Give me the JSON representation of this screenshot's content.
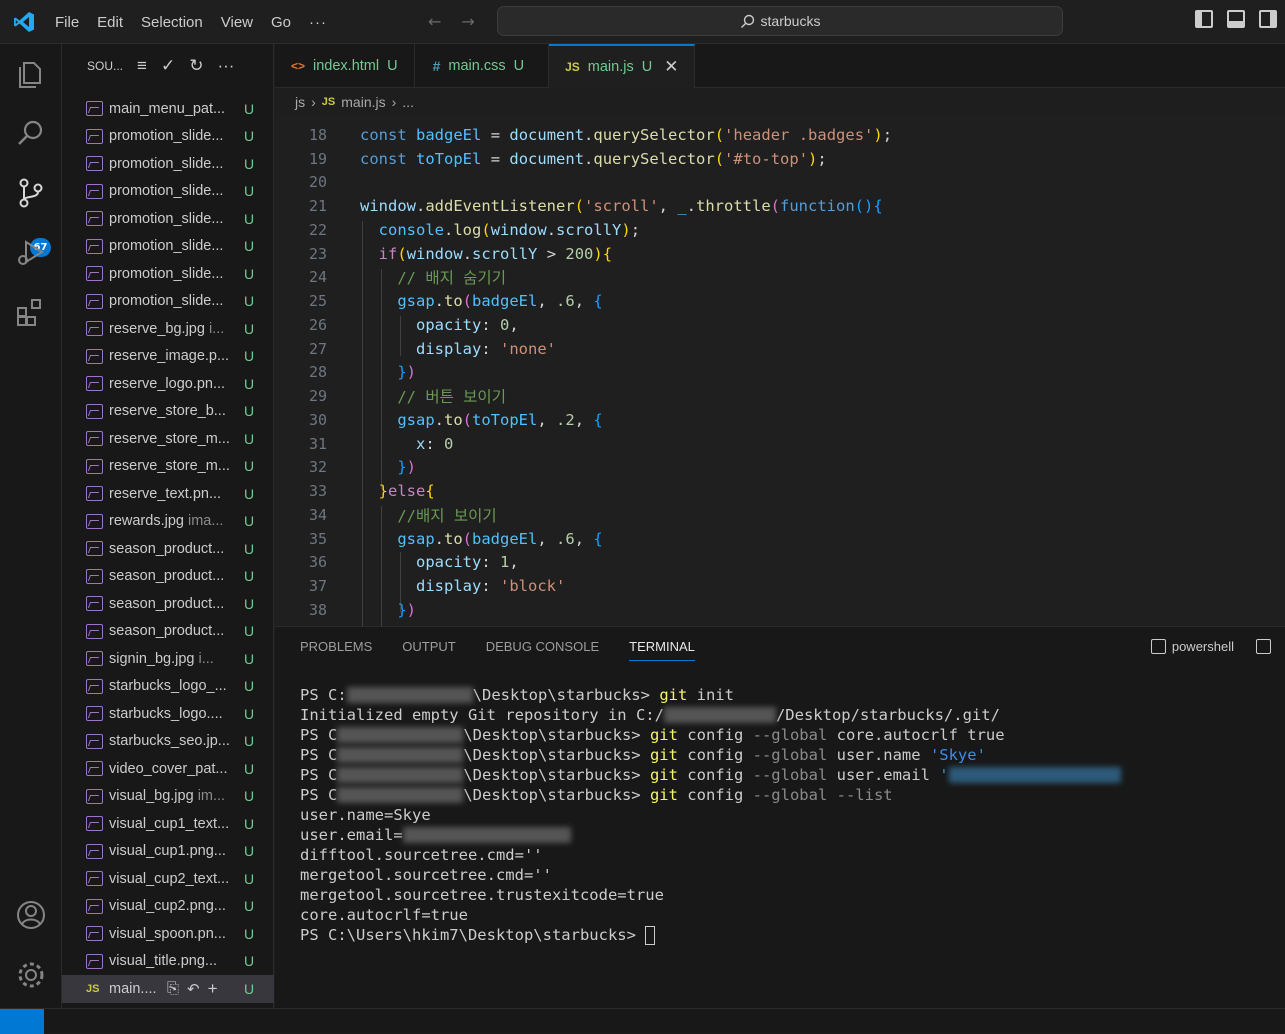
{
  "menu": {
    "file": "File",
    "edit": "Edit",
    "selection": "Selection",
    "view": "View",
    "go": "Go",
    "more": "···"
  },
  "search": {
    "text": "starbucks"
  },
  "activity": {
    "scm_badge": "67"
  },
  "sidebar": {
    "title": "SOU...",
    "files": [
      {
        "name": "main_menu_pat...",
        "status": "U"
      },
      {
        "name": "promotion_slide...",
        "status": "U"
      },
      {
        "name": "promotion_slide...",
        "status": "U"
      },
      {
        "name": "promotion_slide...",
        "status": "U"
      },
      {
        "name": "promotion_slide...",
        "status": "U"
      },
      {
        "name": "promotion_slide...",
        "status": "U"
      },
      {
        "name": "promotion_slide...",
        "status": "U"
      },
      {
        "name": "promotion_slide...",
        "status": "U"
      },
      {
        "name": "reserve_bg.jpg",
        "suffix": "i...",
        "status": "U"
      },
      {
        "name": "reserve_image.p...",
        "status": "U"
      },
      {
        "name": "reserve_logo.pn...",
        "status": "U"
      },
      {
        "name": "reserve_store_b...",
        "status": "U"
      },
      {
        "name": "reserve_store_m...",
        "status": "U"
      },
      {
        "name": "reserve_store_m...",
        "status": "U"
      },
      {
        "name": "reserve_text.pn...",
        "status": "U"
      },
      {
        "name": "rewards.jpg",
        "suffix": "ima...",
        "status": "U"
      },
      {
        "name": "season_product...",
        "status": "U"
      },
      {
        "name": "season_product...",
        "status": "U"
      },
      {
        "name": "season_product...",
        "status": "U"
      },
      {
        "name": "season_product...",
        "status": "U"
      },
      {
        "name": "signin_bg.jpg",
        "suffix": "i...",
        "status": "U"
      },
      {
        "name": "starbucks_logo_...",
        "status": "U"
      },
      {
        "name": "starbucks_logo....",
        "status": "U"
      },
      {
        "name": "starbucks_seo.jp...",
        "status": "U"
      },
      {
        "name": "video_cover_pat...",
        "status": "U"
      },
      {
        "name": "visual_bg.jpg",
        "suffix": "im...",
        "status": "U"
      },
      {
        "name": "visual_cup1_text...",
        "status": "U"
      },
      {
        "name": "visual_cup1.png...",
        "status": "U"
      },
      {
        "name": "visual_cup2_text...",
        "status": "U"
      },
      {
        "name": "visual_cup2.png...",
        "status": "U"
      },
      {
        "name": "visual_spoon.pn...",
        "status": "U"
      },
      {
        "name": "visual_title.png...",
        "status": "U"
      }
    ],
    "selected": {
      "icon": "JS",
      "name": "main....",
      "status": "U"
    }
  },
  "tabs": [
    {
      "icon": "<>",
      "label": "index.html",
      "status": "U"
    },
    {
      "icon": "#",
      "label": "main.css",
      "status": "U"
    },
    {
      "icon": "JS",
      "label": "main.js",
      "status": "U"
    }
  ],
  "breadcrumb": {
    "folder": "js",
    "file": "main.js",
    "more": "..."
  },
  "code": {
    "l18": "18",
    "l19": "19",
    "l20": "20",
    "l21": "21",
    "l22": "22",
    "l23": "23",
    "l24": "24",
    "l25": "25",
    "l26": "26",
    "l27": "27",
    "l28": "28",
    "l29": "29",
    "l30": "30",
    "l31": "31",
    "l32": "32",
    "l33": "33",
    "l34": "34",
    "l35": "35",
    "l36": "36",
    "l37": "37",
    "l38": "38",
    "cmt24": "// 배지 숨기기",
    "cmt29": "// 버튼 보이기",
    "cmt34": "//배지 보이기"
  },
  "panel": {
    "tabs": [
      "PROBLEMS",
      "OUTPUT",
      "DEBUG CONSOLE",
      "TERMINAL"
    ],
    "shell": "powershell"
  },
  "terminal": {
    "p1": "PS C:",
    "p1b": "\\Desktop\\starbucks> ",
    "c1": "git",
    "a1": " init",
    "o1a": "Initialized empty Git repository in C:/",
    "o1b": "/Desktop/starbucks/.git/",
    "p2": "PS C",
    "p2b": "\\Desktop\\starbucks> ",
    "c2": "git",
    "a2": " config ",
    "f2": "--global",
    "b2": " core.autocrlf true",
    "p3": "PS C",
    "p3b": "\\Desktop\\starbucks> ",
    "c3": "git",
    "a3": " config ",
    "f3": "--global",
    "b3": " user.name ",
    "s3": "'Skye'",
    "p4": "PS C",
    "p4b": "\\Desktop\\starbucks> ",
    "c4": "git",
    "a4": " config ",
    "f4": "--global",
    "b4": " user.email ",
    "s4": "'",
    "p5": "PS C",
    "p5b": "\\Desktop\\starbucks> ",
    "c5": "git",
    "a5": " config ",
    "f5": "--global --list",
    "o2": "user.name=Skye",
    "o3": "user.email=",
    "o4": "difftool.sourcetree.cmd=''",
    "o5": "mergetool.sourcetree.cmd=''",
    "o6": "mergetool.sourcetree.trustexitcode=true",
    "o7": "core.autocrlf=true",
    "p6": "PS C:\\Users\\hkim7\\Desktop\\starbucks> "
  }
}
